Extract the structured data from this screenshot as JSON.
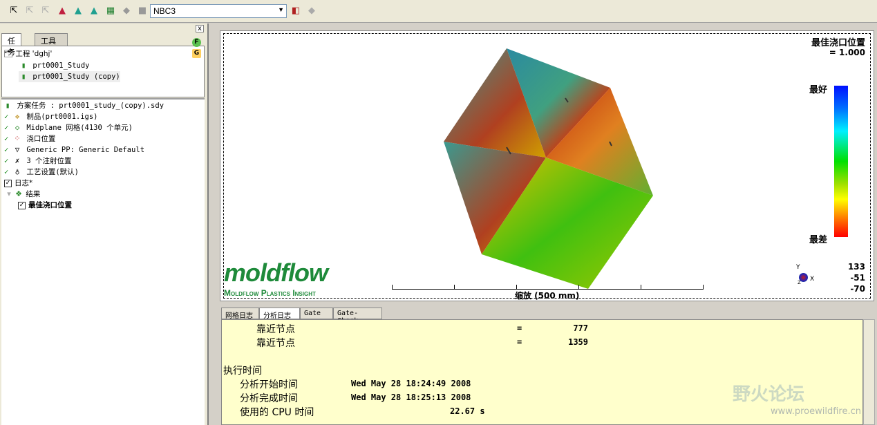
{
  "toolbar": {
    "icons": [
      "select-arrow-icon",
      "lasso-select-icon",
      "select-3-icon",
      "node-red-icon",
      "node-teal-icon",
      "node-mixed-icon",
      "mesh-layer-icon",
      "gem-icon",
      "square-icon",
      "save-view-icon",
      "delete-layer-icon"
    ],
    "combo_value": "NBC3"
  },
  "left_panel": {
    "close": "x",
    "tabs": [
      "任务",
      "工具"
    ],
    "project": {
      "label": "工程 'dghj'",
      "studies": [
        {
          "name": "prt0001_Study",
          "badge": "F",
          "badge_color": "#5cc050"
        },
        {
          "name": "prt0001_Study (copy)",
          "badge": "G",
          "badge_color": "#ffd060"
        }
      ]
    },
    "task": {
      "title": "方案任务 : prt0001_study_(copy).sdy",
      "items": [
        "制品(prt0001.igs)",
        "Midplane 网格(4130 个单元)",
        "浇口位置",
        "Generic PP: Generic Default",
        "3 个注射位置",
        "工艺设置(默认)"
      ],
      "log": "日志*",
      "results": "结果",
      "result_item": "最佳浇口位置"
    }
  },
  "viewport": {
    "legend_title": "最佳浇口位置",
    "legend_value": "= 1.000",
    "best": "最好",
    "worst": "最差",
    "coords": [
      "133",
      "-51",
      "-70"
    ],
    "axes": {
      "x": "X",
      "y": "Y",
      "z": "Z"
    },
    "logo": "moldflow",
    "logo_sub": "Moldflow Plastics Insight",
    "scale_label": "缩放 (500 mm)",
    "watermark": "野火论坛",
    "watermark_url": "www.proewildfire.cn"
  },
  "log": {
    "tabs": [
      "网格日志",
      "分析日志",
      "Gate",
      "Gate-Check"
    ],
    "lines": [
      {
        "label": "靠近节点",
        "eq": "=",
        "value": "777"
      },
      {
        "label": "靠近节点",
        "eq": "=",
        "value": "1359"
      }
    ],
    "section": "执行时间",
    "timing": [
      {
        "label": "分析开始时间",
        "value": "Wed May 28 18:24:49 2008"
      },
      {
        "label": "分析完成时间",
        "value": "Wed May 28 18:25:13 2008"
      },
      {
        "label": "使用的 CPU 时间",
        "value": "22.67 s"
      }
    ]
  }
}
